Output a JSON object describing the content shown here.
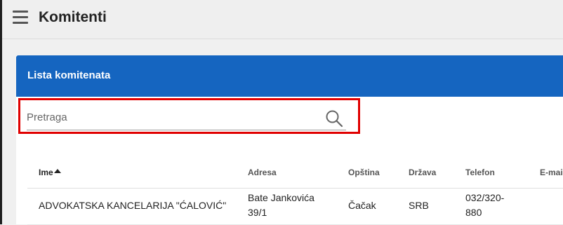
{
  "app": {
    "title": "Komitenti",
    "menu_icon": "hamburger-menu-icon"
  },
  "panel": {
    "title": "Lista komitenata",
    "header_color": "#1565c0"
  },
  "search": {
    "placeholder": "Pretraga",
    "value": "",
    "icon": "search-icon",
    "highlight_color": "#e00000"
  },
  "table": {
    "columns": [
      {
        "label": "Ime",
        "sorted": "ascending"
      },
      {
        "label": "Adresa"
      },
      {
        "label": "Opština"
      },
      {
        "label": "Država"
      },
      {
        "label": "Telefon"
      },
      {
        "label": "E-mai"
      }
    ],
    "rows": [
      {
        "ime": "ADVOKATSKA KANCELARIJA \"ĆALOVIĆ\"",
        "adresa_line1": "Bate Jankovića",
        "adresa_line2": "39/1",
        "opstina": "Čačak",
        "drzava": "SRB",
        "telefon_line1": "032/320-",
        "telefon_line2": "880"
      }
    ]
  }
}
